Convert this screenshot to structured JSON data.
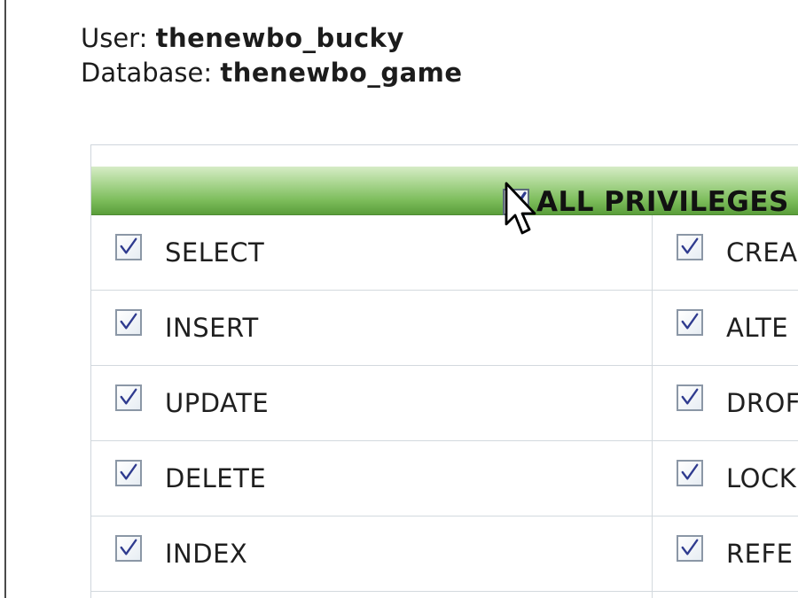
{
  "info": {
    "user_label": "User:",
    "user_value": "thenewbo_bucky",
    "database_label": "Database:",
    "database_value": "thenewbo_game"
  },
  "header": {
    "all_privileges_label": "ALL PRIVILEGES",
    "all_privileges_checked": true
  },
  "privileges": {
    "left": [
      {
        "label": "SELECT",
        "checked": true
      },
      {
        "label": "INSERT",
        "checked": true
      },
      {
        "label": "UPDATE",
        "checked": true
      },
      {
        "label": "DELETE",
        "checked": true
      },
      {
        "label": "INDEX",
        "checked": true
      }
    ],
    "right": [
      {
        "label": "CREA",
        "checked": true
      },
      {
        "label": "ALTE",
        "checked": true
      },
      {
        "label": "DROF",
        "checked": true
      },
      {
        "label": "LOCK",
        "checked": true
      },
      {
        "label": "REFE",
        "checked": true
      }
    ]
  },
  "colors": {
    "header_green": "#7dbd5c",
    "checkmark": "#2f3b8f"
  },
  "icons": {
    "cursor": "mouse-pointer-icon",
    "check": "checkmark-icon"
  }
}
